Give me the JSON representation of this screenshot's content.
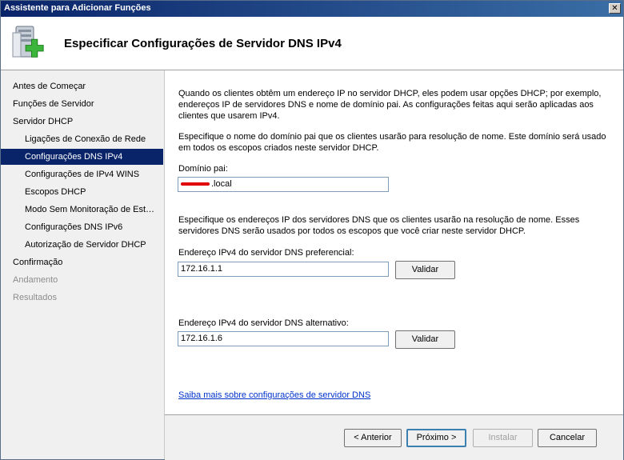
{
  "window": {
    "title": "Assistente para Adicionar Funções",
    "close_glyph": "✕"
  },
  "header": {
    "title": "Especificar Configurações de Servidor DNS IPv4",
    "icon": "server-add-role-icon"
  },
  "sidebar": {
    "items": [
      {
        "label": "Antes de Começar",
        "state": "normal",
        "level": "top"
      },
      {
        "label": "Funções de Servidor",
        "state": "normal",
        "level": "top"
      },
      {
        "label": "Servidor DHCP",
        "state": "normal",
        "level": "top"
      },
      {
        "label": "Ligações de Conexão de Rede",
        "state": "normal",
        "level": "sub"
      },
      {
        "label": "Configurações DNS IPv4",
        "state": "selected",
        "level": "sub"
      },
      {
        "label": "Configurações de IPv4 WINS",
        "state": "normal",
        "level": "sub"
      },
      {
        "label": "Escopos DHCP",
        "state": "normal",
        "level": "sub"
      },
      {
        "label": "Modo Sem Monitoração de Est…",
        "state": "normal",
        "level": "sub"
      },
      {
        "label": "Configurações DNS IPv6",
        "state": "normal",
        "level": "sub"
      },
      {
        "label": "Autorização de Servidor DHCP",
        "state": "normal",
        "level": "sub"
      },
      {
        "label": "Confirmação",
        "state": "normal",
        "level": "top"
      },
      {
        "label": "Andamento",
        "state": "disabled",
        "level": "top"
      },
      {
        "label": "Resultados",
        "state": "disabled",
        "level": "top"
      }
    ]
  },
  "main": {
    "intro": "Quando os clientes obtêm um endereço IP no servidor DHCP, eles podem usar opções DHCP; por exemplo, endereços IP de servidores DNS e nome de domínio pai. As configurações feitas aqui serão aplicadas aos clientes que usarem IPv4.",
    "domain_instruction": "Especifique o nome do domínio pai que os clientes usarão para resolução de nome. Este domínio será usado em todos os escopos criados neste servidor DHCP.",
    "parent_domain_label": "Domínio pai:",
    "parent_domain_value": ".local",
    "dns_instruction": "Especifique os endereços IP dos servidores DNS que os clientes usarão na resolução de nome. Esses servidores DNS serão usados por todos os escopos que você criar neste servidor DHCP.",
    "preferred_label": "Endereço IPv4 do servidor DNS preferencial:",
    "preferred_value": "172.16.1.1",
    "alternate_label": "Endereço IPv4 do servidor DNS alternativo:",
    "alternate_value": "172.16.1.6",
    "validate_label": "Validar",
    "help_link": "Saiba mais sobre configurações de servidor DNS"
  },
  "footer": {
    "back": "< Anterior",
    "next": "Próximo >",
    "install": "Instalar",
    "cancel": "Cancelar"
  },
  "colors": {
    "selection": "#0a246a",
    "link": "#0033cc",
    "redaction": "#e00000"
  }
}
